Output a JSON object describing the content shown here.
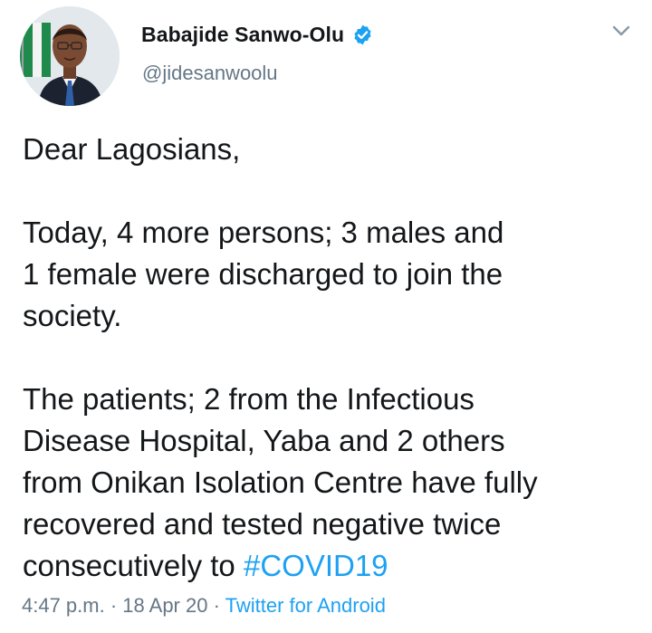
{
  "author": {
    "display_name": "Babajide Sanwo-Olu",
    "handle": "@jidesanwoolu",
    "verified": true
  },
  "tweet": {
    "greeting": "Dear Lagosians,",
    "paragraph_2_lines": [
      "Today, 4 more persons; 3 males and",
      "1 female were discharged to join the",
      "society."
    ],
    "paragraph_3_lines": [
      "The patients; 2 from the Infectious",
      "Disease Hospital, Yaba and 2 others",
      "from Onikan Isolation Centre have fully",
      "recovered and tested negative twice"
    ],
    "last_line_prefix": "consecutively to ",
    "hashtag": "#COVID19"
  },
  "meta": {
    "time": "4:47 p.m.",
    "separator": " · ",
    "date": "18 Apr 20",
    "source": "Twitter for Android"
  },
  "icons": {
    "verified": "verified-badge-icon",
    "menu": "chevron-down-icon"
  },
  "colors": {
    "link": "#1da1f2",
    "secondary_text": "#657786",
    "primary_text": "#14171a"
  }
}
